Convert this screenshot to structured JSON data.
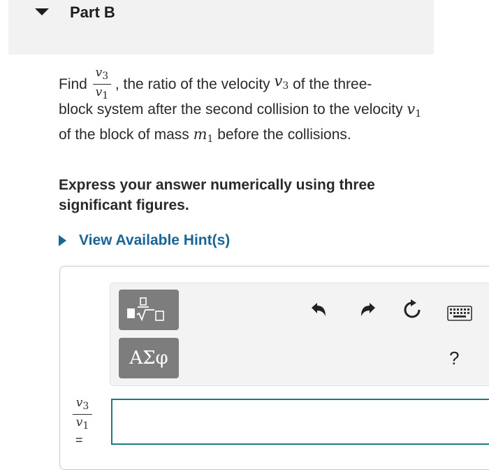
{
  "part": {
    "title": "Part B"
  },
  "question": {
    "find": "Find",
    "ratio_num": "v",
    "ratio_num_sub": "3",
    "ratio_den": "v",
    "ratio_den_sub": "1",
    "comma": ",",
    "text_a": " the ratio of the velocity ",
    "v3": "v",
    "v3_sub": "3",
    "text_b": " of the three-block system after the second collision to the velocity ",
    "v1": "v",
    "v1_sub": "1",
    "text_c": " of the block of mass ",
    "m1": "m",
    "m1_sub": "1",
    "text_d": " before the collisions."
  },
  "instruction": "Express your answer numerically using three significant figures.",
  "hint": {
    "label": "View Available Hint(s)"
  },
  "toolbar": {
    "templates_icon": "fraction-radical-template-icon",
    "symbols_label": "ΑΣφ",
    "undo_icon": "undo-icon",
    "redo_icon": "redo-icon",
    "reset_icon": "reset-icon",
    "keyboard_icon": "keyboard-icon",
    "help_label": "?"
  },
  "answer": {
    "label_num": "v",
    "label_num_sub": "3",
    "label_den": "v",
    "label_den_sub": "1",
    "equals": "=",
    "value": ""
  },
  "colors": {
    "accent": "#1a6496",
    "input_border": "#1a7a86",
    "button_bg": "#7d7d7d",
    "header_bg": "#f2f2f2"
  }
}
